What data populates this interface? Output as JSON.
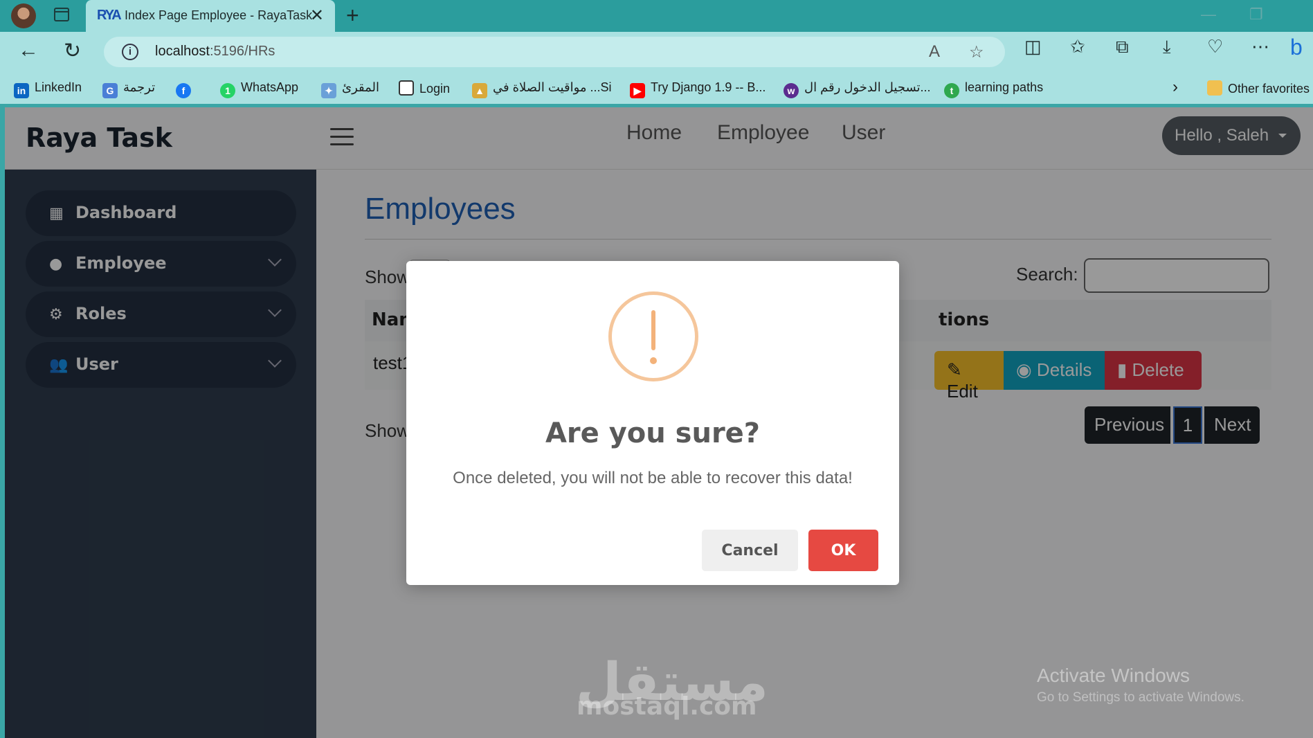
{
  "browser": {
    "tab_title": "Index Page Employee - RayaTask",
    "tab_favicon": "RYA",
    "url_host": "localhost",
    "url_rest": ":5196/HRs",
    "bookmarks": [
      {
        "label": "LinkedIn",
        "icon": "linkedin-icon",
        "color": "#0a66c2"
      },
      {
        "label": "ترجمة",
        "icon": "translate-icon",
        "color": "#4a7fd6"
      },
      {
        "label": "",
        "icon": "facebook-icon",
        "color": "#1877f2"
      },
      {
        "label": "WhatsApp",
        "icon": "whatsapp-icon",
        "color": "#25d366"
      },
      {
        "label": "المقرئ",
        "icon": "quran-icon",
        "color": "#6aa0d8"
      },
      {
        "label": "Login",
        "icon": "page-icon",
        "color": "#ffffff"
      },
      {
        "label": "مواقيت الصلاة في ...Si",
        "icon": "mosque-icon",
        "color": "#d9a93a"
      },
      {
        "label": "Try Django 1.9 -- B...",
        "icon": "youtube-icon",
        "color": "#ff0000"
      },
      {
        "label": "تسجيل الدخول رقم ال...",
        "icon": "web-icon",
        "color": "#5b2c8f"
      },
      {
        "label": "learning paths",
        "icon": "learning-icon",
        "color": "#2fa84f"
      }
    ],
    "other_favorites": "Other favorites"
  },
  "app": {
    "brand": "Raya Task",
    "menu": [
      "Home",
      "Employee",
      "User"
    ],
    "user_greeting": "Hello , Saleh"
  },
  "sidebar": {
    "items": [
      {
        "label": "Dashboard",
        "icon": "dashboard-icon",
        "has_chevron": false
      },
      {
        "label": "Employee",
        "icon": "person-icon",
        "has_chevron": true
      },
      {
        "label": "Roles",
        "icon": "gears-icon",
        "has_chevron": true
      },
      {
        "label": "User",
        "icon": "users-icon",
        "has_chevron": true
      }
    ]
  },
  "main": {
    "title": "Employees",
    "show_label": "Show",
    "search_label": "Search:",
    "columns": [
      "Nam",
      "tions"
    ],
    "rows": [
      {
        "name": "test1"
      }
    ],
    "actions": {
      "edit": "Edit",
      "details": "Details",
      "delete": "Delete"
    },
    "showing_label": "Showi",
    "pagination": {
      "previous": "Previous",
      "current": "1",
      "next": "Next"
    }
  },
  "modal": {
    "title": "Are you sure?",
    "text": "Once deleted, you will not be able to recover this data!",
    "cancel": "Cancel",
    "ok": "OK"
  },
  "watermark": {
    "logo_text": "مستقل",
    "domain": "mostaql.com"
  },
  "windows_notice": {
    "line1": "Activate Windows",
    "line2": "Go to Settings to activate Windows."
  },
  "colors": {
    "accent": "#1e5fb4",
    "delete": "#dc3545",
    "details": "#12a5c4",
    "edit": "#f7c02a",
    "ok_button": "#e64942",
    "sidebar": "#2f3d4f"
  }
}
